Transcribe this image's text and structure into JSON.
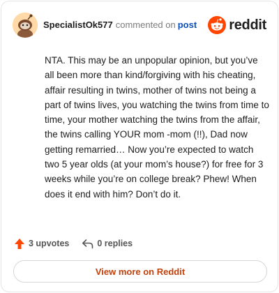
{
  "comment": {
    "username": "SpecialistOk577",
    "action_text": "commented on",
    "post_link_label": "post",
    "body": "NTA. This may be an unpopular opinion, but you’ve all been more than kind/forgiving with his cheating, affair resulting in twins, mother of twins not being a part of twins lives, you watching the twins from time to time, your mother watching the twins from the affair, the twins calling YOUR mom -mom (!!), Dad now getting remarried… Now you’re expected to watch two 5 year olds (at your mom’s house?) for free for 3 weeks while you’re on college break? Phew! When does it end with him? Don’t do it."
  },
  "brand": {
    "logo_icon": "reddit-snoo-icon",
    "name": "reddit",
    "color": "#ff4500"
  },
  "actions": {
    "upvotes_label": "3 upvotes",
    "replies_label": "0 replies"
  },
  "footer": {
    "view_more_label": "View more on Reddit"
  },
  "colors": {
    "link": "#0a4fb5",
    "upvote": "#ff4500",
    "view_more": "#c2410c"
  }
}
